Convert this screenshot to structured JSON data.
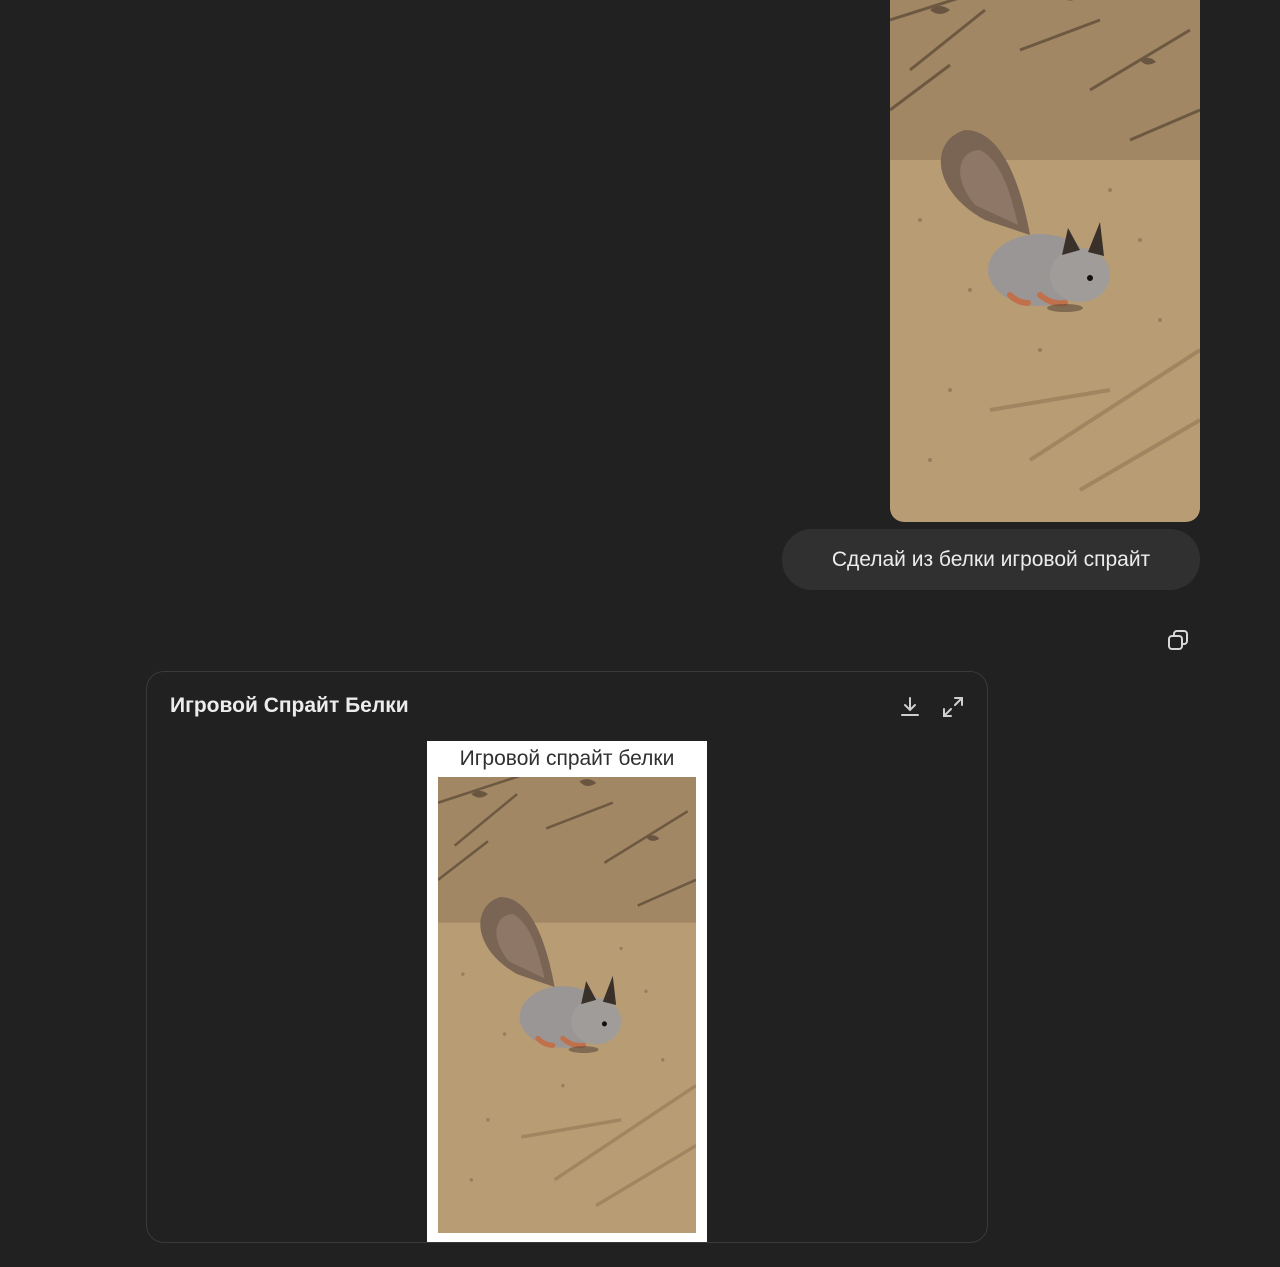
{
  "conversation": {
    "user_message": {
      "image_alt": "squirrel-photo",
      "text": "Сделай из белки игровой спрайт"
    },
    "copy_icon": "copy-icon"
  },
  "artifact": {
    "title": "Игровой Спрайт Белки",
    "download_icon": "download-icon",
    "expand_icon": "expand-icon",
    "sprite": {
      "caption": "Игровой спрайт белки",
      "frame_color": "#ffffff"
    }
  },
  "colors": {
    "background": "#212121",
    "bubble": "#303030",
    "text": "#ececec"
  }
}
